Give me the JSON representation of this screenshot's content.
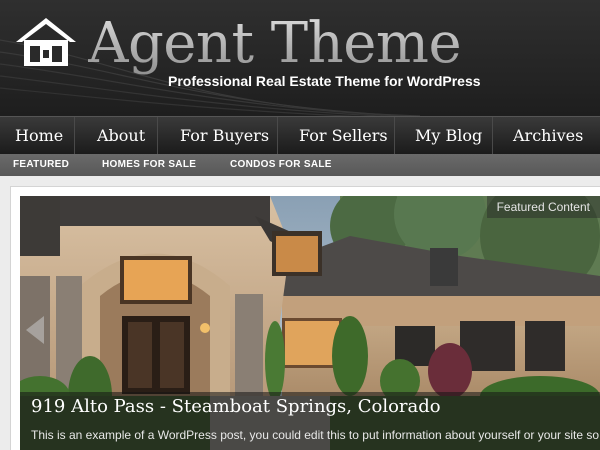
{
  "header": {
    "site_title": "Agent Theme",
    "tagline": "Professional Real Estate Theme for WordPress",
    "logo_icon": "house-logo-icon"
  },
  "primary_nav": {
    "items": [
      {
        "label": "Home"
      },
      {
        "label": "About"
      },
      {
        "label": "For Buyers"
      },
      {
        "label": "For Sellers"
      },
      {
        "label": "My Blog"
      },
      {
        "label": "Archives"
      }
    ]
  },
  "secondary_nav": {
    "items": [
      {
        "label": "FEATURED"
      },
      {
        "label": "HOMES FOR SALE"
      },
      {
        "label": "CONDOS FOR SALE"
      }
    ]
  },
  "slider": {
    "featured_label": "Featured Content",
    "prev_icon": "arrow-left-icon",
    "caption_title": "919 Alto Pass - Steamboat Springs, Colorado",
    "caption_excerpt": "This is an example of a WordPress post, you could edit this to put information about yourself or your site so"
  },
  "colors": {
    "header_bg": "#262626",
    "nav_bg": "#1b1b1b",
    "subnav_bg": "#5e5e5e",
    "page_bg": "#ececec"
  }
}
